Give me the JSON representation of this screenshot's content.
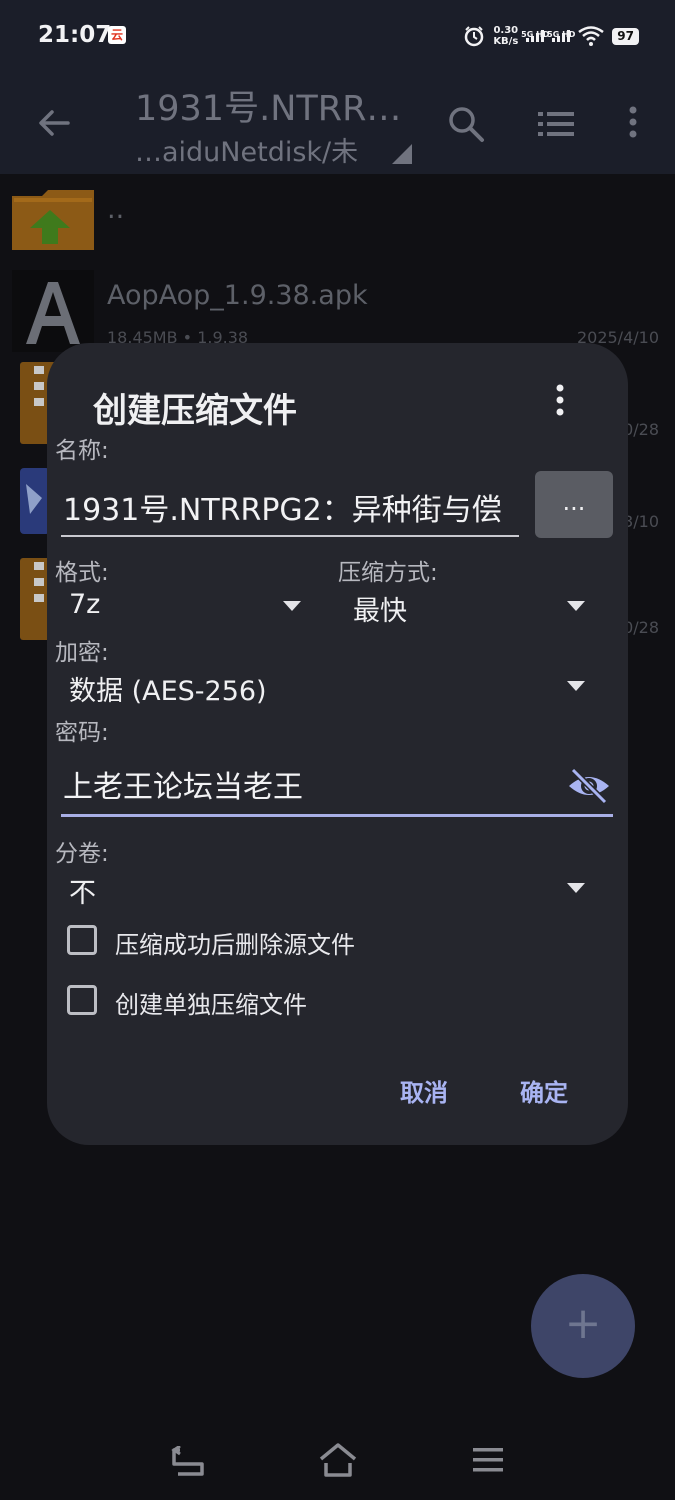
{
  "status_bar": {
    "time": "21:07",
    "app_icon_glyph": "云",
    "net_speed_value": "0.30",
    "net_speed_unit": "KB/s",
    "sim1_label": "5G HD",
    "sim2_label": "5G HD",
    "battery": "97",
    "icons": [
      "alarm-icon",
      "signal-icon",
      "wifi-icon",
      "battery-icon"
    ]
  },
  "toolbar": {
    "title": "1931号.NTRR…",
    "path": "…aiduNetdisk/未",
    "icons": [
      "back-arrow-icon",
      "search-icon",
      "list-view-icon",
      "more-vert-icon"
    ]
  },
  "file_list": [
    {
      "name": "..",
      "icon": "folder-up-icon",
      "meta": "",
      "date": ""
    },
    {
      "name": "AopAop_1.9.38.apk",
      "icon": "apk-app-icon",
      "meta": "18.45MB  • 1.9.38",
      "date": "2025/4/10"
    },
    {
      "name": "",
      "icon": "7z-archive-icon",
      "meta": "",
      "date": "0/28"
    },
    {
      "name": "",
      "icon": "app-icon",
      "meta": "",
      "date": "3/10"
    },
    {
      "name": "",
      "icon": "zip-archive-icon",
      "meta": "",
      "date": "0/28"
    }
  ],
  "dialog": {
    "title": "创建压缩文件",
    "name_label": "名称:",
    "name_value": "1931号.NTRRPG2：异种街与偿",
    "browse_label": "...",
    "format_label": "格式:",
    "format_value": "7z",
    "method_label": "压缩方式:",
    "method_value": "最快",
    "encrypt_label": "加密:",
    "encrypt_value": "数据 (AES-256)",
    "password_label": "密码:",
    "password_value": "上老王论坛当老王",
    "split_label": "分卷:",
    "split_value": "不",
    "checkbox_delete_label": "压缩成功后删除源文件",
    "checkbox_delete_checked": false,
    "checkbox_separate_label": "创建单独压缩文件",
    "checkbox_separate_checked": false,
    "cancel_label": "取消",
    "ok_label": "确定"
  },
  "fab": {
    "glyph": "+",
    "icon": "add-icon"
  },
  "colors": {
    "background": "#101014",
    "toolbar": "#1b1e29",
    "dialog": "#25262d",
    "accent": "#a9b4f2",
    "fab": "#3e4568"
  }
}
